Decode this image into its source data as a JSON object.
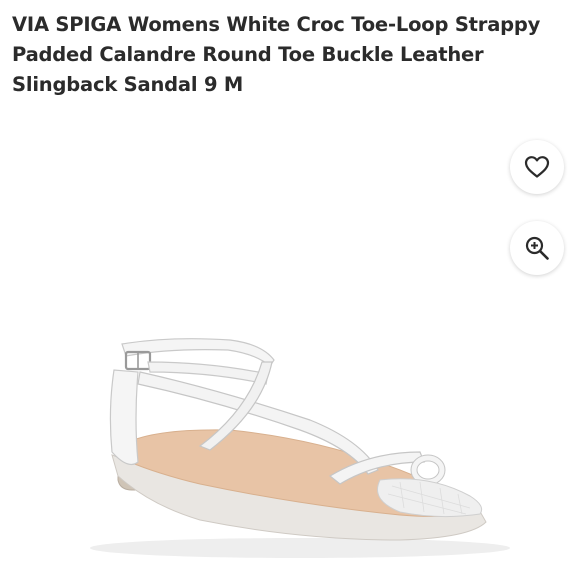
{
  "product": {
    "title": "VIA SPIGA Womens White Croc Toe-Loop Strappy Padded Calandre Round Toe Buckle Leather Slingback Sandal 9 M"
  },
  "actions": {
    "favorite_icon": "heart-icon",
    "zoom_icon": "zoom-in-icon"
  },
  "colors": {
    "text": "#2b2b2b",
    "strap": "#f4f4f4",
    "footbed": "#e8c4a6"
  }
}
